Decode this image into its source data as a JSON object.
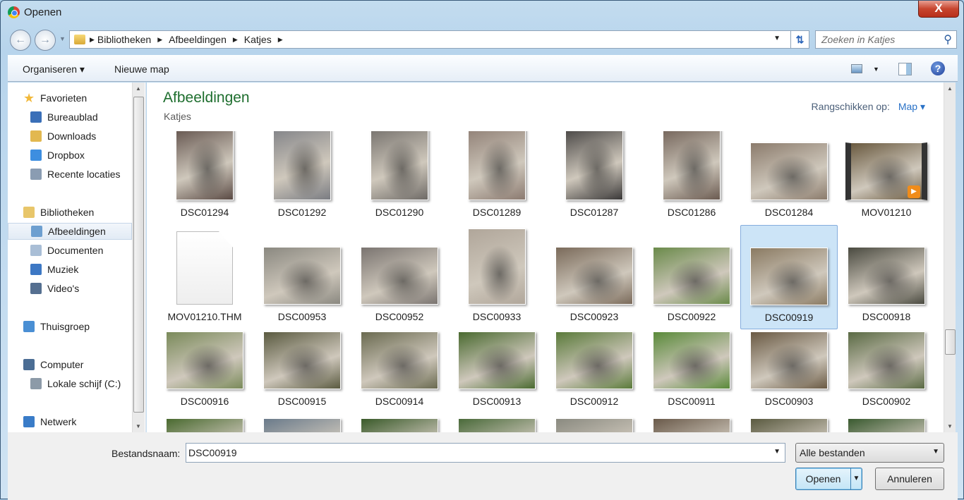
{
  "window": {
    "title": "Openen",
    "close_label": "X"
  },
  "address": {
    "crumbs": [
      "Bibliotheken",
      "Afbeeldingen",
      "Katjes"
    ],
    "search_placeholder": "Zoeken in Katjes"
  },
  "toolbar": {
    "organize": "Organiseren ▾",
    "new_folder": "Nieuwe map"
  },
  "sidebar": {
    "items": [
      {
        "label": "Favorieten",
        "icon": "star-icon",
        "color": "#f2b93b",
        "indent": 0
      },
      {
        "label": "Bureaublad",
        "icon": "desktop-icon",
        "color": "#3a6fb8",
        "indent": 1
      },
      {
        "label": "Downloads",
        "icon": "downloads-folder-icon",
        "color": "#e2b850",
        "indent": 1
      },
      {
        "label": "Dropbox",
        "icon": "dropbox-icon",
        "color": "#3d8ee0",
        "indent": 1
      },
      {
        "label": "Recente locaties",
        "icon": "recent-locations-icon",
        "color": "#8a9cb2",
        "indent": 1
      },
      {
        "label": "Bibliotheken",
        "icon": "libraries-icon",
        "color": "#e8c66a",
        "indent": 0
      },
      {
        "label": "Afbeeldingen",
        "icon": "pictures-library-icon",
        "color": "#6d9fd0",
        "indent": 1,
        "selected": true
      },
      {
        "label": "Documenten",
        "icon": "documents-library-icon",
        "color": "#a9bed6",
        "indent": 1
      },
      {
        "label": "Muziek",
        "icon": "music-library-icon",
        "color": "#3d78c4",
        "indent": 1
      },
      {
        "label": "Video's",
        "icon": "videos-library-icon",
        "color": "#556f90",
        "indent": 1
      },
      {
        "label": "Thuisgroep",
        "icon": "homegroup-icon",
        "color": "#4a8fd4",
        "indent": 0
      },
      {
        "label": "Computer",
        "icon": "computer-icon",
        "color": "#4b6d94",
        "indent": 0
      },
      {
        "label": "Lokale schijf (C:)",
        "icon": "local-disk-icon",
        "color": "#8c9aa8",
        "indent": 1
      },
      {
        "label": "Netwerk",
        "icon": "network-icon",
        "color": "#3a7cc8",
        "indent": 0
      }
    ]
  },
  "main": {
    "title": "Afbeeldingen",
    "subtitle": "Katjes",
    "arrange_label": "Rangschikken op:",
    "arrange_value": "Map ▾"
  },
  "files": [
    [
      {
        "name": "DSC01294",
        "o": "p",
        "c": "#5a4a44"
      },
      {
        "name": "DSC01292",
        "o": "p",
        "c": "#7a7c82"
      },
      {
        "name": "DSC01290",
        "o": "p",
        "c": "#6e6a66"
      },
      {
        "name": "DSC01289",
        "o": "p",
        "c": "#8b7a70"
      },
      {
        "name": "DSC01287",
        "o": "p",
        "c": "#3a3838"
      },
      {
        "name": "DSC01286",
        "o": "p",
        "c": "#6a5a50"
      },
      {
        "name": "DSC01284",
        "o": "l",
        "c": "#8b7b6c"
      },
      {
        "name": "MOV01210",
        "o": "l",
        "c": "#6a5a40",
        "video": true
      }
    ],
    [
      {
        "name": "MOV01210.THM",
        "o": "doc"
      },
      {
        "name": "DSC00953",
        "o": "l",
        "c": "#8a8880"
      },
      {
        "name": "DSC00952",
        "o": "l",
        "c": "#7a7470"
      },
      {
        "name": "DSC00933",
        "o": "p",
        "c": "#b0a69a"
      },
      {
        "name": "DSC00923",
        "o": "l",
        "c": "#7a6a5a"
      },
      {
        "name": "DSC00922",
        "o": "l",
        "c": "#6a8a4a"
      },
      {
        "name": "DSC00919",
        "o": "l",
        "c": "#8a7a62",
        "selected": true
      },
      {
        "name": "DSC00918",
        "o": "l",
        "c": "#4a4a40"
      }
    ],
    [
      {
        "name": "DSC00916",
        "o": "l",
        "c": "#7a8a5a"
      },
      {
        "name": "DSC00915",
        "o": "l",
        "c": "#5a5a40"
      },
      {
        "name": "DSC00914",
        "o": "l",
        "c": "#6a6a50"
      },
      {
        "name": "DSC00913",
        "o": "l",
        "c": "#4a6a30"
      },
      {
        "name": "DSC00912",
        "o": "l",
        "c": "#5a7a3a"
      },
      {
        "name": "DSC00911",
        "o": "l",
        "c": "#5a8a3a"
      },
      {
        "name": "DSC00903",
        "o": "l",
        "c": "#6a5a44"
      },
      {
        "name": "DSC00902",
        "o": "l",
        "c": "#5a6a44"
      }
    ],
    [
      {
        "name": "",
        "o": "l",
        "c": "#4a6a30"
      },
      {
        "name": "",
        "o": "l",
        "c": "#6a7a8a"
      },
      {
        "name": "",
        "o": "l",
        "c": "#3a5a2a"
      },
      {
        "name": "",
        "o": "l",
        "c": "#4a6a3a"
      },
      {
        "name": "",
        "o": "l",
        "c": "#8a8a80"
      },
      {
        "name": "",
        "o": "l",
        "c": "#6a5a4a"
      },
      {
        "name": "",
        "o": "l",
        "c": "#5a5a40"
      },
      {
        "name": "",
        "o": "l",
        "c": "#3a5a30"
      }
    ]
  ],
  "bottom": {
    "filename_label": "Bestandsnaam:",
    "filename_value": "DSC00919",
    "filetype": "Alle bestanden",
    "open": "Openen",
    "cancel": "Annuleren"
  }
}
